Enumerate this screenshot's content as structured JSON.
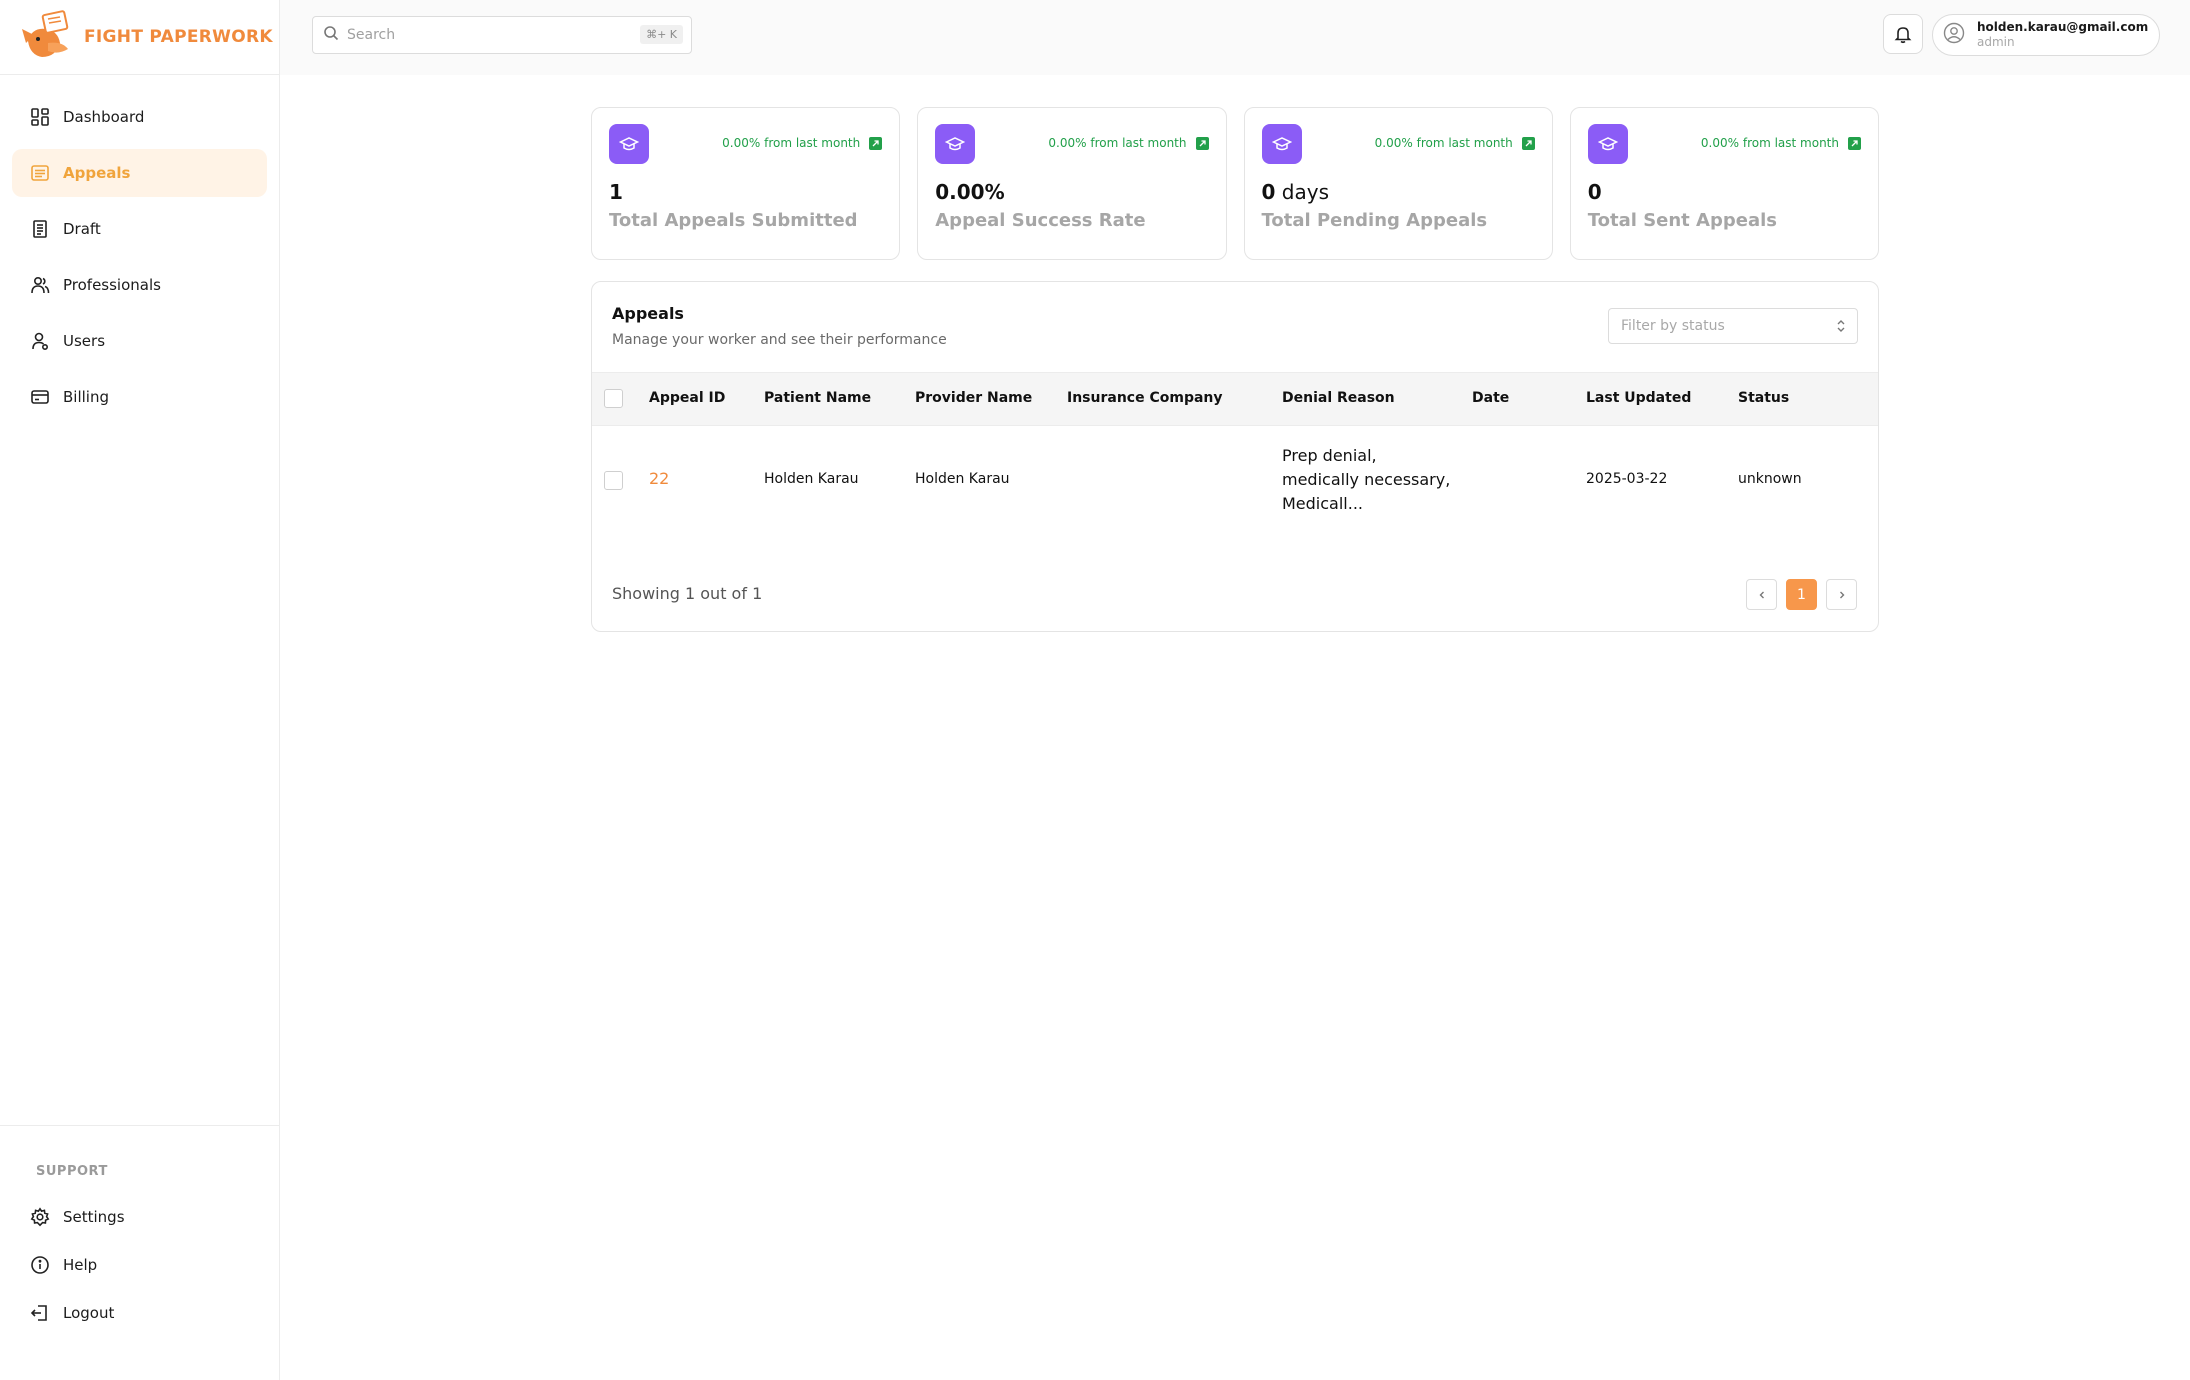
{
  "brand": {
    "name": "FIGHT PAPERWORK",
    "accent": "#f08a3c"
  },
  "sidebar": {
    "items": [
      {
        "label": "Dashboard",
        "icon": "dashboard-icon"
      },
      {
        "label": "Appeals",
        "icon": "list-icon",
        "active": true
      },
      {
        "label": "Draft",
        "icon": "document-icon"
      },
      {
        "label": "Professionals",
        "icon": "users-group-icon"
      },
      {
        "label": "Users",
        "icon": "user-icon"
      },
      {
        "label": "Billing",
        "icon": "credit-card-icon"
      }
    ],
    "support_title": "SUPPORT",
    "support_items": [
      {
        "label": "Settings",
        "icon": "gear-icon"
      },
      {
        "label": "Help",
        "icon": "info-icon"
      },
      {
        "label": "Logout",
        "icon": "logout-icon"
      }
    ]
  },
  "header": {
    "search_placeholder": "Search",
    "search_shortcut": "⌘+ K",
    "user_email": "holden.karau@gmail.com",
    "user_role": "admin"
  },
  "stats": [
    {
      "value": "1",
      "unit": "",
      "label": "Total Appeals Submitted",
      "trend": "0.00% from last month"
    },
    {
      "value": "0.00%",
      "unit": "",
      "label": "Appeal Success Rate",
      "trend": "0.00% from last month"
    },
    {
      "value": "0",
      "unit": " days",
      "label": "Total Pending Appeals",
      "trend": "0.00% from last month"
    },
    {
      "value": "0",
      "unit": "",
      "label": "Total Sent Appeals",
      "trend": "0.00% from last month"
    }
  ],
  "appeals": {
    "title": "Appeals",
    "subtitle": "Manage your worker and see their performance",
    "filter_placeholder": "Filter by status",
    "columns": [
      "Appeal ID",
      "Patient Name",
      "Provider Name",
      "Insurance Company",
      "Denial Reason",
      "Date",
      "Last Updated",
      "Status"
    ],
    "rows": [
      {
        "appeal_id": "22",
        "patient_name": "Holden Karau",
        "provider_name": "Holden Karau",
        "insurance_company": "",
        "denial_reason": "Prep denial, medically necessary, Medicall...",
        "date": "",
        "last_updated": "2025-03-22",
        "status": "unknown"
      }
    ],
    "footer": "Showing 1 out of 1",
    "current_page": "1"
  }
}
